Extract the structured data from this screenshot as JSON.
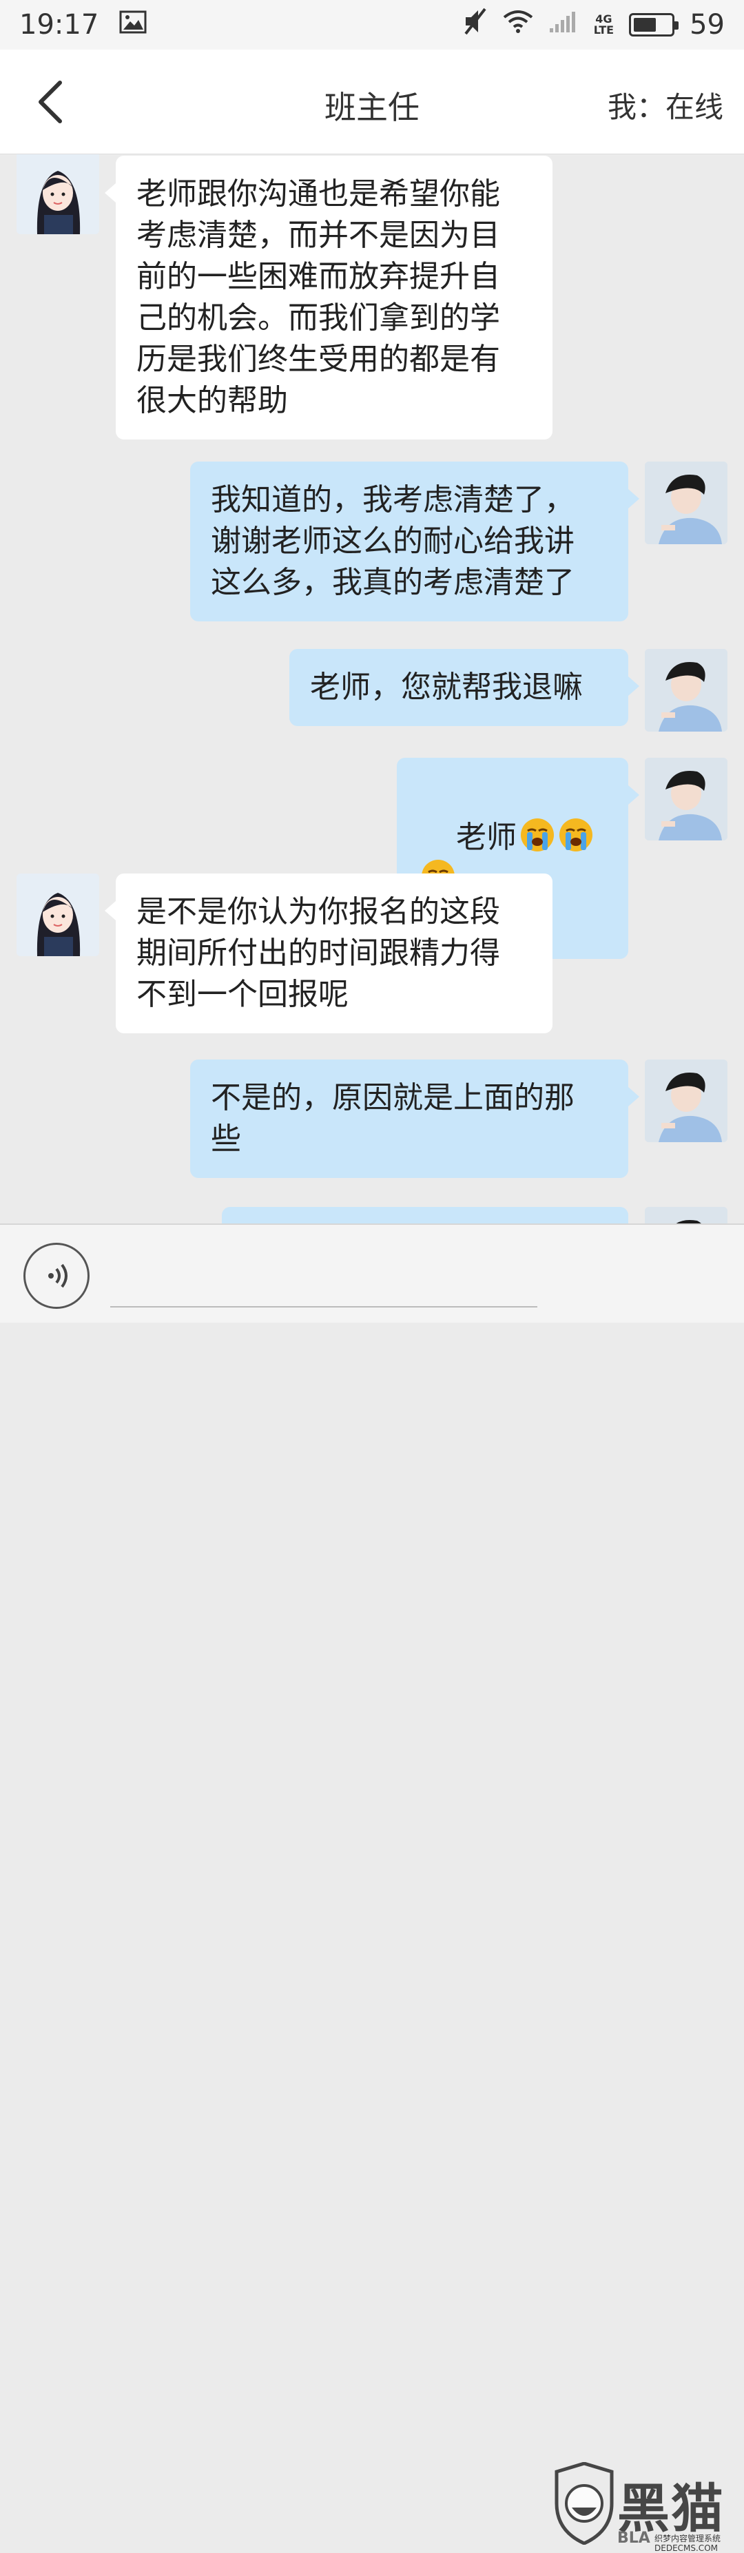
{
  "status_bar": {
    "time": "19:17",
    "network_type_top": "4G",
    "network_type_bottom": "LTE",
    "battery_level": "59",
    "battery_fill_fraction": 0.59
  },
  "header": {
    "title": "班主任",
    "online_status": "我：在线"
  },
  "messages": [
    {
      "sender": "teacher",
      "text": "老师跟你沟通也是希望你能\n考虑清楚，而并不是因为目\n前的一些困难而放弃提升自\n己的机会。而我们拿到的学\n历是我们终生受用的都是有\n很大的帮助"
    },
    {
      "sender": "me",
      "text": "我知道的，我考虑清楚了，\n谢谢老师这么的耐心给我讲\n这么多，我真的考虑清楚了"
    },
    {
      "sender": "me",
      "text": "老师，您就帮我退嘛"
    },
    {
      "sender": "me",
      "text": "老师",
      "emojis": [
        "loudly-crying-face",
        "loudly-crying-face",
        "loudly-crying-face"
      ]
    },
    {
      "sender": "teacher",
      "text": "是不是你认为你报名的这段\n期间所付出的时间跟精力得\n不到一个回报呢"
    },
    {
      "sender": "me",
      "text": "不是的，原因就是上面的那\n些"
    }
  ],
  "watermark": {
    "brand": "黑猫",
    "english": "BLA",
    "site": "织梦内容管理系统\nDEDECMS.COM"
  },
  "colors": {
    "incoming_bubble": "#ffffff",
    "outgoing_bubble": "#c9e6fa",
    "chat_background": "#ebebeb"
  }
}
